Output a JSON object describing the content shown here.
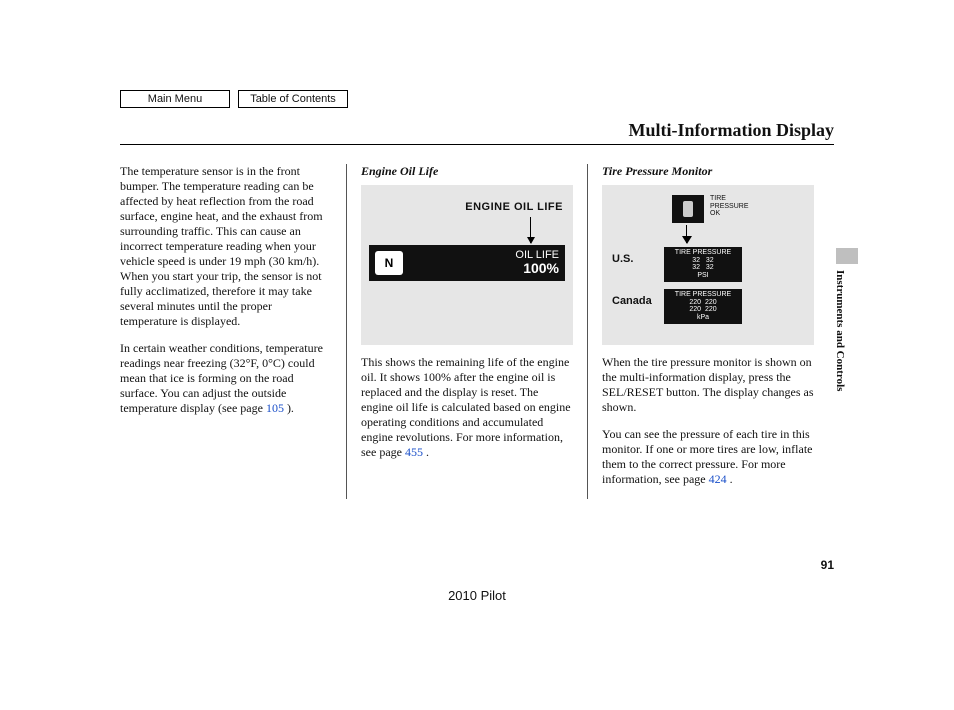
{
  "nav": {
    "main_menu": "Main Menu",
    "toc": "Table of Contents"
  },
  "title": "Multi-Information Display",
  "col1": {
    "p1": "The temperature sensor is in the front bumper. The temperature reading can be affected by heat reflection from the road surface, engine heat, and the exhaust from surrounding traffic. This can cause an incorrect temperature reading when your vehicle speed is under 19 mph (30 km/h). When you start your trip, the sensor is not fully acclimatized, therefore it may take several minutes until the proper temperature is displayed.",
    "p2a": "In certain weather conditions, temperature readings near freezing (32°F, 0°C) could mean that ice is forming on the road surface. You can adjust the outside temperature display (see page ",
    "p2link": "105",
    "p2b": " )."
  },
  "col2": {
    "heading": "Engine Oil Life",
    "illus": {
      "label": "ENGINE OIL LIFE",
      "n": "N",
      "line1": "OIL LIFE",
      "line2": "100%"
    },
    "p1a": "This shows the remaining life of the engine oil. It shows 100% after the engine oil is replaced and the display is reset. The engine oil life is calculated based on engine operating conditions and accumulated engine revolutions. For more information, see page ",
    "p1link": "455",
    "p1b": " ."
  },
  "col3": {
    "heading": "Tire Pressure Monitor",
    "illus": {
      "ok": "TIRE\nPRESSURE\nOK",
      "us": "U.S.",
      "ca": "Canada",
      "tp_us_title": "TIRE PRESSURE",
      "tp_us_vals": "32   32\n32   32\nPSI",
      "tp_ca_title": "TIRE PRESSURE",
      "tp_ca_vals": "220  220\n220  220\nkPa"
    },
    "p1": "When the tire pressure monitor is shown on the multi-information display, press the SEL/RESET button. The display changes as shown.",
    "p2a": "You can see the pressure of each tire in this monitor. If one or more tires are low, inflate them to the correct pressure. For more information, see page ",
    "p2link": "424",
    "p2b": " ."
  },
  "side_label": "Instruments and Controls",
  "page_number": "91",
  "model": "2010 Pilot"
}
